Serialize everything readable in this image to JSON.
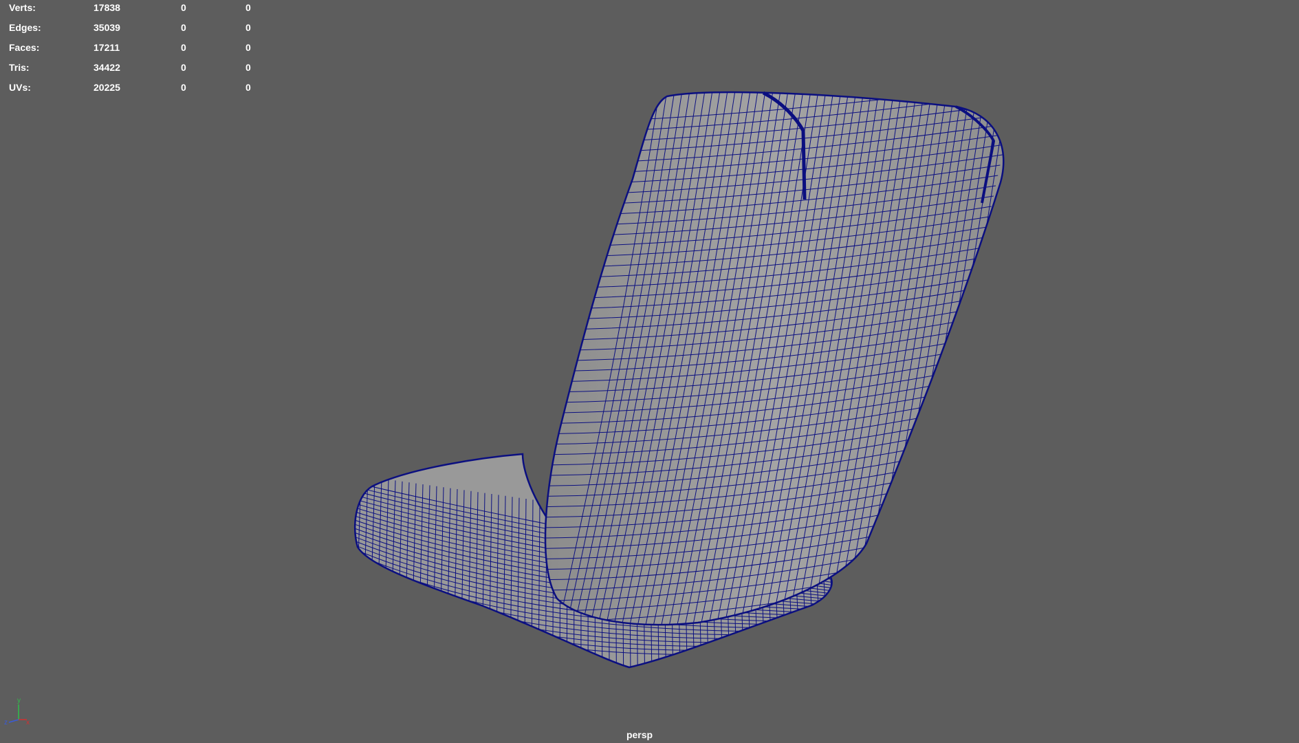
{
  "hud": {
    "rows": [
      {
        "label": "Verts:",
        "v1": "17838",
        "v2": "0",
        "v3": "0"
      },
      {
        "label": "Edges:",
        "v1": "35039",
        "v2": "0",
        "v3": "0"
      },
      {
        "label": "Faces:",
        "v1": "17211",
        "v2": "0",
        "v3": "0"
      },
      {
        "label": "Tris:",
        "v1": "34422",
        "v2": "0",
        "v3": "0"
      },
      {
        "label": "UVs:",
        "v1": "20225",
        "v2": "0",
        "v3": "0"
      }
    ]
  },
  "viewport": {
    "camera": "persp",
    "background_color": "#5d5d5d",
    "wire_color": "#0b0f80",
    "mesh_color": "#9a9a9a"
  },
  "axis_gizmo": {
    "y_label": "y",
    "x_label": "x",
    "z_label": "z",
    "colors": {
      "x": "#d23030",
      "y": "#2fbf4a",
      "z": "#3a5bd8"
    }
  }
}
